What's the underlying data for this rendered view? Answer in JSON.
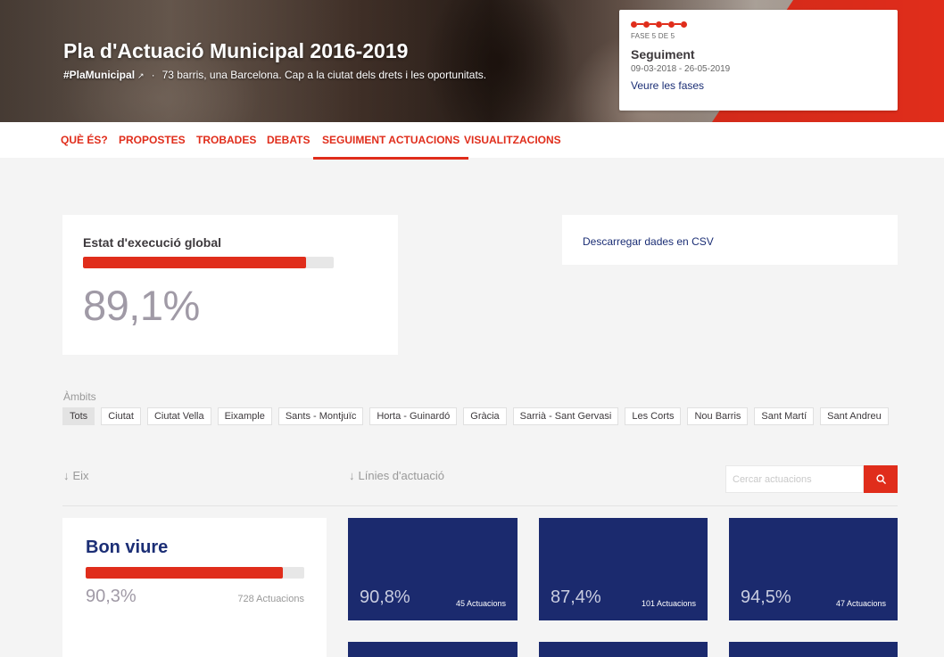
{
  "header": {
    "title": "Pla d'Actuació Municipal 2016-2019",
    "hashtag": "#PlaMunicipal",
    "subtitle": "73 barris, una Barcelona. Cap a la ciutat dels drets i les oportunitats."
  },
  "phase": {
    "number_label": "FASE 5 DE 5",
    "name": "Seguiment",
    "dates": "09-03-2018 - 26-05-2019",
    "link": "Veure les fases"
  },
  "tabs": [
    {
      "label": "QUÈ ÉS?",
      "active": false
    },
    {
      "label": "PROPOSTES",
      "active": false
    },
    {
      "label": "TROBADES",
      "active": false
    },
    {
      "label": "DEBATS",
      "active": false
    },
    {
      "label": "SEGUIMENT ACTUACIONS",
      "active": true
    },
    {
      "label": "VISUALITZACIONS",
      "active": false
    }
  ],
  "execution": {
    "title": "Estat d'execució global",
    "value_label": "89,1%",
    "progress": 0.891
  },
  "csv": {
    "link": "Descarregar dades en CSV"
  },
  "ambits": {
    "label": "Àmbits",
    "filters": [
      "Tots",
      "Ciutat",
      "Ciutat Vella",
      "Eixample",
      "Sants - Montjuïc",
      "Horta - Guinardó",
      "Gràcia",
      "Sarrià - Sant Gervasi",
      "Les Corts",
      "Nou Barris",
      "Sant Martí",
      "Sant Andreu"
    ],
    "active": "Tots"
  },
  "sort": {
    "eix": "Eix",
    "linies": "Línies d'actuació"
  },
  "search": {
    "placeholder": "Cercar actuacions"
  },
  "eix_card": {
    "title": "Bon viure",
    "value_label": "90,3%",
    "progress": 0.903,
    "count": "728 Actuacions"
  },
  "lines": [
    {
      "value_label": "90,8%",
      "count": "45 Actuacions"
    },
    {
      "value_label": "87,4%",
      "count": "101 Actuacions"
    },
    {
      "value_label": "94,5%",
      "count": "47 Actuacions"
    },
    {
      "value_label": "",
      "count": ""
    },
    {
      "value_label": "",
      "count": ""
    },
    {
      "value_label": "",
      "count": ""
    }
  ],
  "colors": {
    "accent": "#e02d1b",
    "navy": "#1b2e75",
    "tile": "#1b2a6e"
  }
}
